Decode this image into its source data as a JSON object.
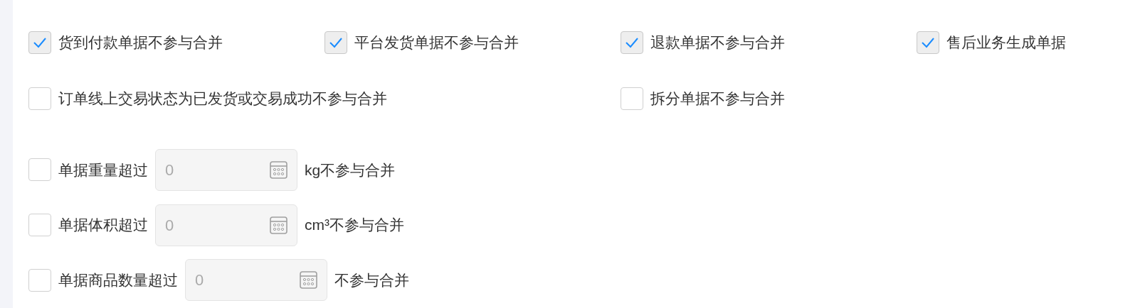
{
  "checkbox_rows": [
    [
      {
        "label": "货到付款单据不参与合并",
        "checked": true,
        "kind": "normal"
      },
      {
        "label": "平台发货单据不参与合并",
        "checked": true,
        "kind": "normal"
      },
      {
        "label": "退款单据不参与合并",
        "checked": true,
        "kind": "normal"
      },
      {
        "label": "售后业务生成单据",
        "checked": true,
        "kind": "normal"
      }
    ],
    [
      {
        "label": "订单线上交易状态为已发货或交易成功不参与合并",
        "checked": false,
        "kind": "wide"
      },
      {
        "label": "拆分单据不参与合并",
        "checked": false,
        "kind": "normal"
      }
    ]
  ],
  "threshold_rows": [
    {
      "label": "单据重量超过",
      "checked": false,
      "value": "0",
      "disabled": true,
      "suffix": "kg不参与合并"
    },
    {
      "label": "单据体积超过",
      "checked": false,
      "value": "0",
      "disabled": true,
      "suffix": "cm³不参与合并"
    },
    {
      "label": "单据商品数量超过",
      "checked": false,
      "value": "0",
      "disabled": true,
      "suffix": "不参与合并"
    }
  ]
}
